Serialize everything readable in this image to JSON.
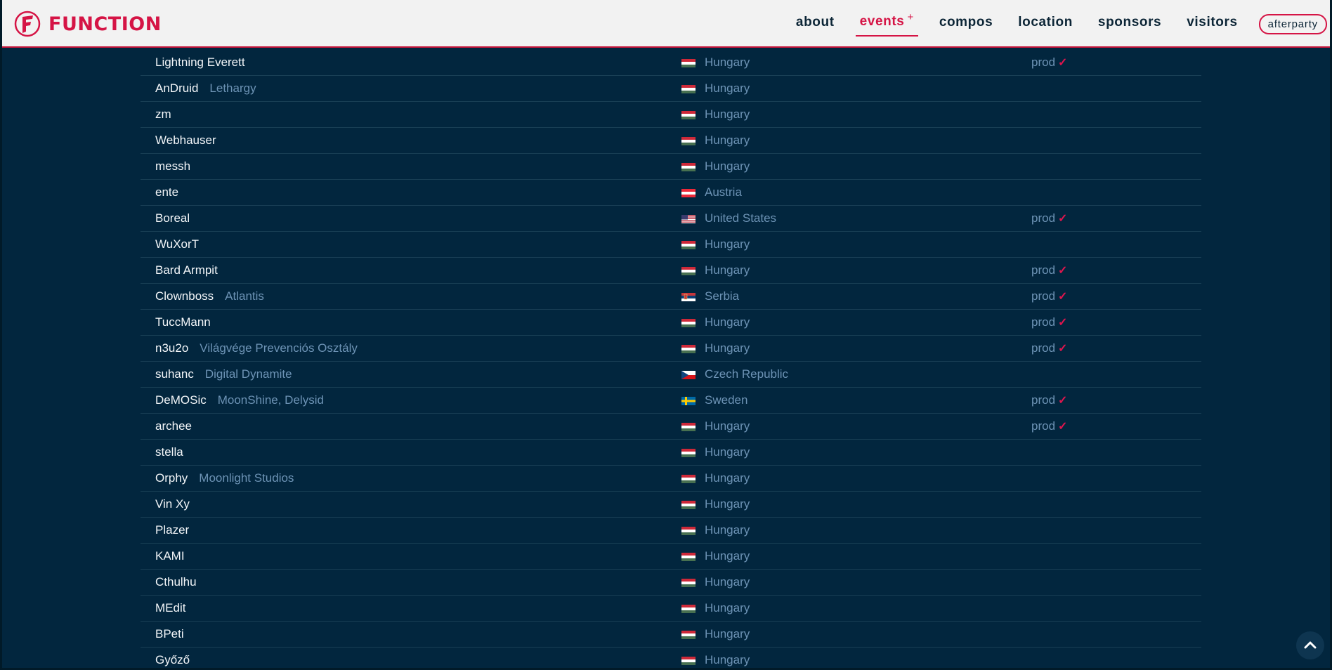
{
  "brand": {
    "name": "FUNCTION"
  },
  "nav": {
    "items": [
      {
        "label": "about",
        "active": false
      },
      {
        "label": "events",
        "active": true,
        "suffix": "+"
      },
      {
        "label": "compos",
        "active": false
      },
      {
        "label": "location",
        "active": false
      },
      {
        "label": "sponsors",
        "active": false
      },
      {
        "label": "visitors",
        "active": false
      }
    ],
    "button": "afterparty"
  },
  "colors": {
    "accent": "#d51445",
    "background": "#02263e",
    "muted_text": "#6d93b5"
  },
  "visitors": [
    {
      "name": "Lightning Everett",
      "group": "",
      "country": "Hungary",
      "flag": "hu",
      "prod": "prod"
    },
    {
      "name": "AnDruid",
      "group": "Lethargy",
      "country": "Hungary",
      "flag": "hu",
      "prod": ""
    },
    {
      "name": "zm",
      "group": "",
      "country": "Hungary",
      "flag": "hu",
      "prod": ""
    },
    {
      "name": "Webhauser",
      "group": "",
      "country": "Hungary",
      "flag": "hu",
      "prod": ""
    },
    {
      "name": "messh",
      "group": "",
      "country": "Hungary",
      "flag": "hu",
      "prod": ""
    },
    {
      "name": "ente",
      "group": "",
      "country": "Austria",
      "flag": "at",
      "prod": ""
    },
    {
      "name": "Boreal",
      "group": "",
      "country": "United States",
      "flag": "us",
      "prod": "prod"
    },
    {
      "name": "WuXorT",
      "group": "",
      "country": "Hungary",
      "flag": "hu",
      "prod": ""
    },
    {
      "name": "Bard Armpit",
      "group": "",
      "country": "Hungary",
      "flag": "hu",
      "prod": "prod"
    },
    {
      "name": "Clownboss",
      "group": "Atlantis",
      "country": "Serbia",
      "flag": "rs",
      "prod": "prod"
    },
    {
      "name": "TuccMann",
      "group": "",
      "country": "Hungary",
      "flag": "hu",
      "prod": "prod"
    },
    {
      "name": "n3u2o",
      "group": "Világvége Prevenciós Osztály",
      "country": "Hungary",
      "flag": "hu",
      "prod": "prod"
    },
    {
      "name": "suhanc",
      "group": "Digital Dynamite",
      "country": "Czech Republic",
      "flag": "cz",
      "prod": ""
    },
    {
      "name": "DeMOSic",
      "group": "MoonShine, Delysid",
      "country": "Sweden",
      "flag": "se",
      "prod": "prod"
    },
    {
      "name": "archee",
      "group": "",
      "country": "Hungary",
      "flag": "hu",
      "prod": "prod"
    },
    {
      "name": "stella",
      "group": "",
      "country": "Hungary",
      "flag": "hu",
      "prod": ""
    },
    {
      "name": "Orphy",
      "group": "Moonlight Studios",
      "country": "Hungary",
      "flag": "hu",
      "prod": ""
    },
    {
      "name": "Vin Xy",
      "group": "",
      "country": "Hungary",
      "flag": "hu",
      "prod": ""
    },
    {
      "name": "Plazer",
      "group": "",
      "country": "Hungary",
      "flag": "hu",
      "prod": ""
    },
    {
      "name": "KAMI",
      "group": "",
      "country": "Hungary",
      "flag": "hu",
      "prod": ""
    },
    {
      "name": "Cthulhu",
      "group": "",
      "country": "Hungary",
      "flag": "hu",
      "prod": ""
    },
    {
      "name": "MEdit",
      "group": "",
      "country": "Hungary",
      "flag": "hu",
      "prod": ""
    },
    {
      "name": "BPeti",
      "group": "",
      "country": "Hungary",
      "flag": "hu",
      "prod": ""
    },
    {
      "name": "Győző",
      "group": "",
      "country": "Hungary",
      "flag": "hu",
      "prod": ""
    }
  ]
}
